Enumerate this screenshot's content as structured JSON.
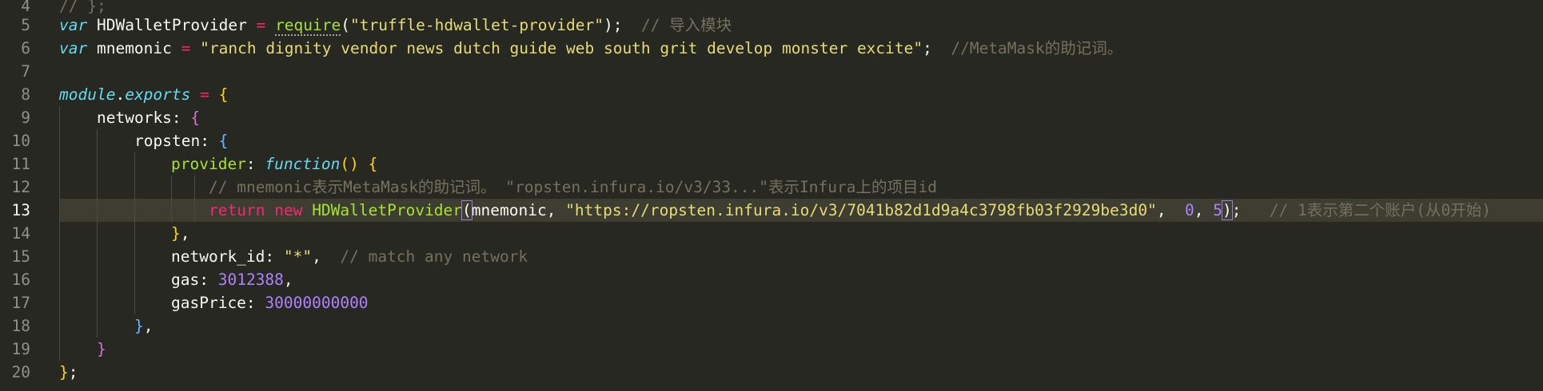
{
  "lines": [
    {
      "num": "4",
      "parts": [
        "// };"
      ]
    },
    {
      "num": "5",
      "parts": [
        "var",
        " HDWalletProvider ",
        "=",
        " ",
        "require",
        "(",
        "\"truffle-hdwallet-provider\"",
        ");",
        "  // 导入模块"
      ]
    },
    {
      "num": "6",
      "parts": [
        "var",
        " mnemonic ",
        "=",
        " ",
        "\"ranch dignity vendor news dutch guide web south grit develop monster excite\"",
        ";",
        "  //MetaMask的助记词。"
      ]
    },
    {
      "num": "7",
      "parts": []
    },
    {
      "num": "8",
      "parts": [
        "module",
        ".",
        "exports",
        " = ",
        "{"
      ]
    },
    {
      "num": "9",
      "parts": [
        "networks",
        ": ",
        "{"
      ]
    },
    {
      "num": "10",
      "parts": [
        "ropsten",
        ": ",
        "{"
      ]
    },
    {
      "num": "11",
      "parts": [
        "provider",
        ": ",
        "function",
        "()",
        " ",
        "{"
      ]
    },
    {
      "num": "12",
      "parts": [
        "// mnemonic表示MetaMask的助记词。 \"ropsten.infura.io/v3/33...\"表示Infura上的项目id"
      ]
    },
    {
      "num": "13",
      "parts": [
        "return",
        " ",
        "new",
        " ",
        "HDWalletProvider",
        "(",
        "mnemonic, ",
        "\"https://ropsten.infura.io/v3/7041b82d1d9a4c3798fb03f2929be3d0\"",
        ",  ",
        "0",
        ", ",
        "5",
        ")",
        ";",
        "   // 1表示第二个账户(从0开始)"
      ]
    },
    {
      "num": "14",
      "parts": [
        "}",
        ","
      ]
    },
    {
      "num": "15",
      "parts": [
        "network_id",
        ": ",
        "\"*\"",
        ",  ",
        "// match any network"
      ]
    },
    {
      "num": "16",
      "parts": [
        "gas",
        ": ",
        "3012388",
        ","
      ]
    },
    {
      "num": "17",
      "parts": [
        "gasPrice",
        ": ",
        "30000000000"
      ]
    },
    {
      "num": "18",
      "parts": [
        "}",
        ","
      ]
    },
    {
      "num": "19",
      "parts": [
        "}"
      ]
    },
    {
      "num": "20",
      "parts": [
        "}",
        ";"
      ]
    }
  ],
  "colors": {
    "background": "#272822",
    "current_line": "#3e3d32",
    "keyword": "#f92672",
    "storage": "#66d9ef",
    "function": "#a6e22e",
    "string": "#e6db74",
    "number": "#ae81ff",
    "comment": "#75715e"
  }
}
